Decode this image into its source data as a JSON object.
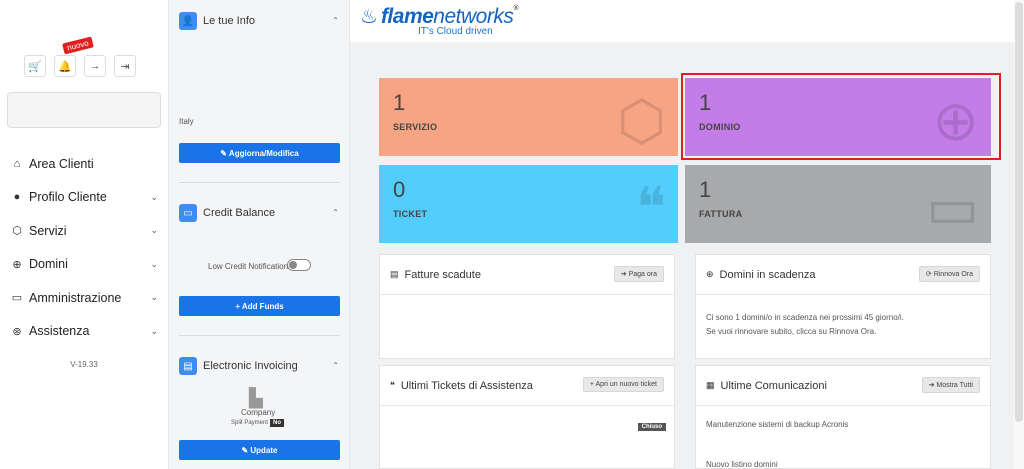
{
  "sidebar": {
    "top_icons": [
      {
        "name": "cart-icon",
        "glyph": "🛒"
      },
      {
        "name": "bell-icon",
        "glyph": "🔔"
      },
      {
        "name": "arrow-right-icon",
        "glyph": "→"
      },
      {
        "name": "logout-icon",
        "glyph": "⇥"
      }
    ],
    "nuovo_badge": "nuovo",
    "nav": [
      {
        "label": "Area Clienti",
        "icon": "home-icon",
        "glyph": "⌂",
        "chevron": false
      },
      {
        "label": "Profilo Cliente",
        "icon": "user-icon",
        "glyph": "●",
        "chevron": true
      },
      {
        "label": "Servizi",
        "icon": "box-icon",
        "glyph": "⬡",
        "chevron": true
      },
      {
        "label": "Domini",
        "icon": "globe-icon",
        "glyph": "⊕",
        "chevron": true
      },
      {
        "label": "Amministrazione",
        "icon": "card-icon",
        "glyph": "▭",
        "chevron": true
      },
      {
        "label": "Assistenza",
        "icon": "lifebuoy-icon",
        "glyph": "⊛",
        "chevron": true
      }
    ],
    "version": "V-19.33"
  },
  "col2": {
    "info_title": "Le tue Info",
    "country": "Italy",
    "update_btn": "✎ Aggiorna/Modifica",
    "credit_title": "Credit Balance",
    "low_credit": "Low Credit Notification",
    "add_funds_btn": "+ Add Funds",
    "invoicing_title": "Electronic Invoicing",
    "company": "Company",
    "split_payment": "Split Payment",
    "no_badge": "No",
    "update2_btn": "✎ Update"
  },
  "header": {
    "logo_bold": "flame",
    "logo_normal": "networks",
    "reg": "®",
    "tagline": "IT's Cloud driven"
  },
  "tiles": [
    {
      "num": "1",
      "label": "SERVIZIO",
      "color": "#f7a484"
    },
    {
      "num": "1",
      "label": "DOMINIO",
      "color": "#c47de8"
    },
    {
      "num": "0",
      "label": "TICKET",
      "color": "#53cdfb"
    },
    {
      "num": "1",
      "label": "FATTURA",
      "color": "#a7a9ab"
    }
  ],
  "cards": {
    "fatture_title": "Fatture scadute",
    "fatture_btn": "➔ Paga ora",
    "domini_title": "Domini in scadenza",
    "domini_btn": "⟳ Rinnova Ora",
    "domini_line1": "Ci sono 1 domini/o in scadenza nei prossimi 45 giorno/i.",
    "domini_line2": "Se vuoi rinnovare subito, clicca su Rinnova Ora.",
    "tickets_title": "Ultimi Tickets di Assistenza",
    "tickets_btn": "+ Apri un nuovo ticket",
    "chiuso": "Chiuso",
    "comunicazioni_title": "Ultime Comunicazioni",
    "comunicazioni_btn": "➔ Mostra Tutti",
    "comunicazioni_item1": "Manutenzione sistemi di backup Acronis",
    "comunicazioni_item2": "Nuovo listino domini"
  }
}
